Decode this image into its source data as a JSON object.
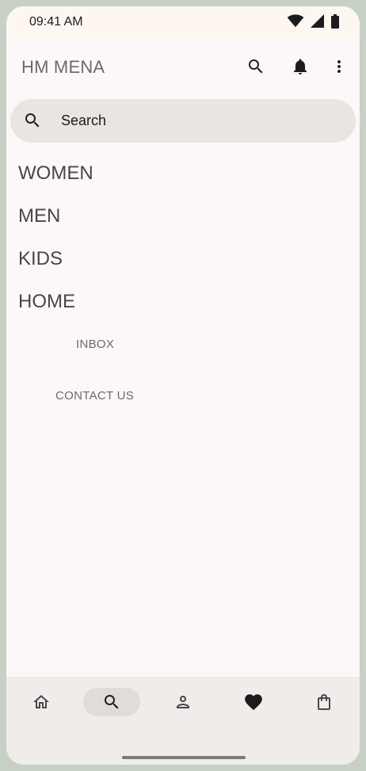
{
  "status_bar": {
    "time": "09:41 AM",
    "icons": [
      "wifi-icon",
      "cellular-icon",
      "battery-icon"
    ]
  },
  "header": {
    "title": "HM MENA",
    "actions": [
      "search-icon",
      "bell-icon",
      "more-vert-icon"
    ]
  },
  "search": {
    "placeholder": "Search"
  },
  "categories": [
    {
      "label": "WOMEN"
    },
    {
      "label": "MEN"
    },
    {
      "label": "KIDS"
    },
    {
      "label": "HOME"
    }
  ],
  "links": {
    "inbox": "INBOX",
    "contact": "CONTACT US"
  },
  "bottom_nav": {
    "items": [
      "home-icon",
      "search-icon",
      "account-icon",
      "favorite-icon",
      "shopping-bag-icon"
    ],
    "active": "search-icon"
  },
  "colors": {
    "background": "#fcf8f7",
    "search_bg": "#e9e5e3",
    "nav_bg": "#f0ecea",
    "frame": "#c7d0c5"
  }
}
